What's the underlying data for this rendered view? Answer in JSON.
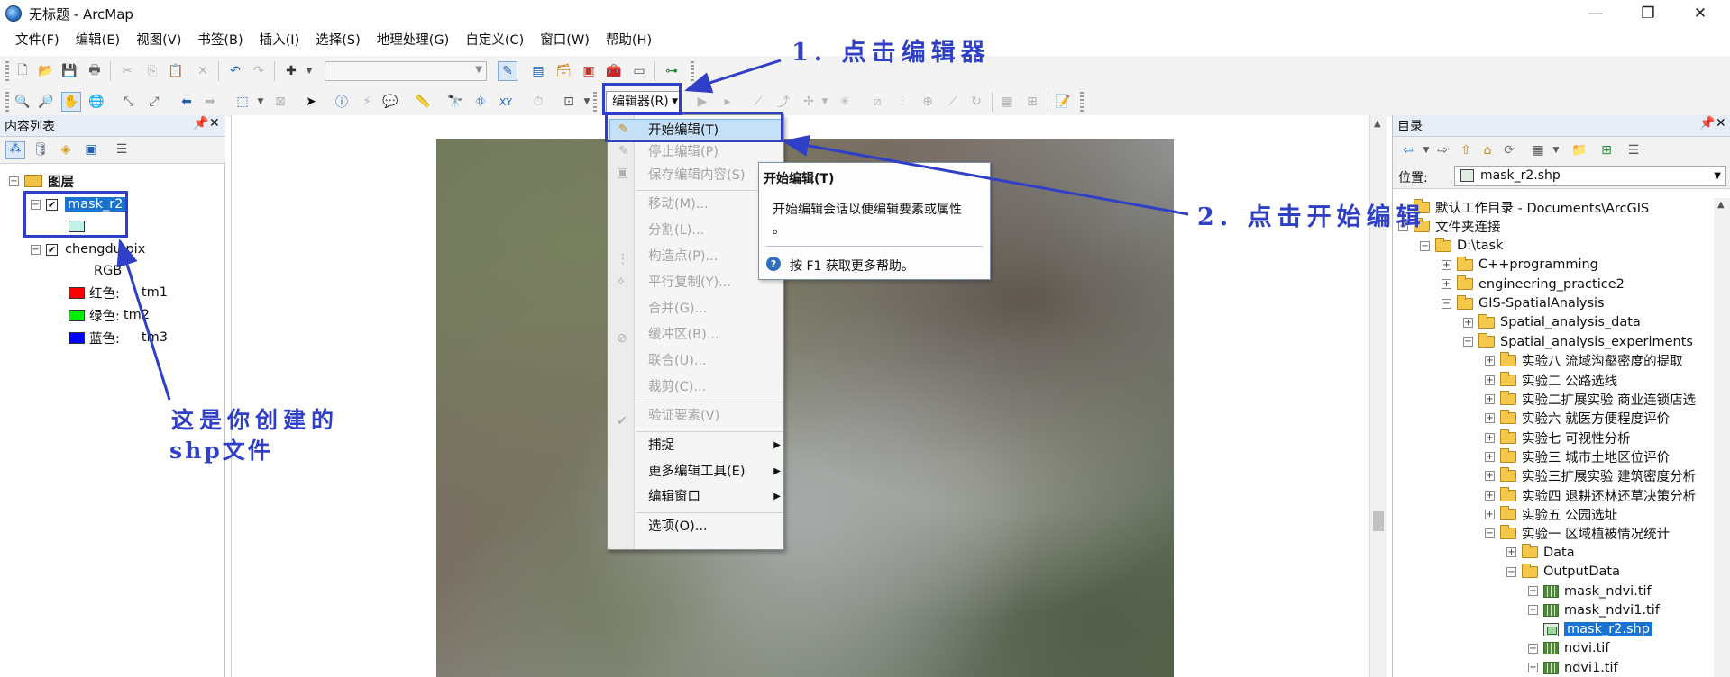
{
  "window": {
    "title": "无标题 - ArcMap",
    "minimize_glyph": "—",
    "maximize_glyph": "❐",
    "close_glyph": "✕"
  },
  "menubar": [
    "文件(F)",
    "编辑(E)",
    "视图(V)",
    "书签(B)",
    "插入(I)",
    "选择(S)",
    "地理处理(G)",
    "自定义(C)",
    "窗口(W)",
    "帮助(H)"
  ],
  "editor_toolbar": {
    "label": "编辑器(R)"
  },
  "toc": {
    "title": "内容列表",
    "root_label": "图层",
    "layers": [
      {
        "name": "mask_r2",
        "checked": true
      },
      {
        "name": "chengdu.pix",
        "checked": true,
        "subtitle": "RGB"
      }
    ],
    "bands": [
      {
        "label": "红色:",
        "value": "tm1",
        "color": "#ff0000"
      },
      {
        "label": "绿色:",
        "value": "tm2",
        "color": "#00ee00"
      },
      {
        "label": "蓝色:",
        "value": "tm3",
        "color": "#0000ff"
      }
    ],
    "mask_swatch_color": "#bff2ea"
  },
  "editor_menu": {
    "items": [
      {
        "label": "开始编辑(T)",
        "enabled": true,
        "highlighted": true
      },
      {
        "label": "停止编辑(P)",
        "enabled": false
      },
      {
        "label": "保存编辑内容(S)",
        "enabled": false
      },
      {
        "label": "移动(M)...",
        "enabled": false
      },
      {
        "label": "分割(L)...",
        "enabled": false
      },
      {
        "label": "构造点(P)...",
        "enabled": false
      },
      {
        "label": "平行复制(Y)...",
        "enabled": false
      },
      {
        "label": "合并(G)...",
        "enabled": false
      },
      {
        "label": "缓冲区(B)...",
        "enabled": false
      },
      {
        "label": "联合(U)...",
        "enabled": false
      },
      {
        "label": "裁剪(C)...",
        "enabled": false
      },
      {
        "label": "验证要素(V)",
        "enabled": false
      },
      {
        "label": "捕捉",
        "enabled": true,
        "submenu": true
      },
      {
        "label": "更多编辑工具(E)",
        "enabled": true,
        "submenu": true
      },
      {
        "label": "编辑窗口",
        "enabled": true,
        "submenu": true
      },
      {
        "label": "选项(O)...",
        "enabled": true
      }
    ]
  },
  "tooltip": {
    "title": "开始编辑(T)",
    "body_line1": "开始编辑会话以便编辑要素或属性",
    "body_line2": "。",
    "help": "按 F1 获取更多帮助。"
  },
  "catalog": {
    "title": "目录",
    "location_label": "位置:",
    "location_value": "mask_r2.shp",
    "tree": [
      {
        "label": "默认工作目录 - Documents\\ArcGIS",
        "indent": 0,
        "icon": "folder",
        "expander": ""
      },
      {
        "label": "文件夹连接",
        "indent": 0,
        "icon": "folder",
        "expander": "−"
      },
      {
        "label": "D:\\task",
        "indent": 1,
        "icon": "folder",
        "expander": "−"
      },
      {
        "label": "C++programming",
        "indent": 2,
        "icon": "folder",
        "expander": "+"
      },
      {
        "label": "engineering_practice2",
        "indent": 2,
        "icon": "folder",
        "expander": "+"
      },
      {
        "label": "GIS-SpatialAnalysis",
        "indent": 2,
        "icon": "folder",
        "expander": "−"
      },
      {
        "label": "Spatial_analysis_data",
        "indent": 3,
        "icon": "folder",
        "expander": "+"
      },
      {
        "label": "Spatial_analysis_experiments",
        "indent": 3,
        "icon": "folder",
        "expander": "−"
      },
      {
        "label": "实验八 流域沟壑密度的提取",
        "indent": 4,
        "icon": "folder",
        "expander": "+"
      },
      {
        "label": "实验二 公路选线",
        "indent": 4,
        "icon": "folder",
        "expander": "+"
      },
      {
        "label": "实验二扩展实验 商业连锁店选",
        "indent": 4,
        "icon": "folder",
        "expander": "+"
      },
      {
        "label": "实验六 就医方便程度评价",
        "indent": 4,
        "icon": "folder",
        "expander": "+"
      },
      {
        "label": "实验七 可视性分析",
        "indent": 4,
        "icon": "folder",
        "expander": "+"
      },
      {
        "label": "实验三 城市土地区位评价",
        "indent": 4,
        "icon": "folder",
        "expander": "+"
      },
      {
        "label": "实验三扩展实验 建筑密度分析",
        "indent": 4,
        "icon": "folder",
        "expander": "+"
      },
      {
        "label": "实验四 退耕还林还草决策分析",
        "indent": 4,
        "icon": "folder",
        "expander": "+"
      },
      {
        "label": "实验五 公园选址",
        "indent": 4,
        "icon": "folder",
        "expander": "+"
      },
      {
        "label": "实验一 区域植被情况统计",
        "indent": 4,
        "icon": "folder",
        "expander": "−"
      },
      {
        "label": "Data",
        "indent": 5,
        "icon": "folder",
        "expander": "+"
      },
      {
        "label": "OutputData",
        "indent": 5,
        "icon": "folder",
        "expander": "−"
      },
      {
        "label": "mask_ndvi.tif",
        "indent": 6,
        "icon": "raster",
        "expander": "+"
      },
      {
        "label": "mask_ndvi1.tif",
        "indent": 6,
        "icon": "raster",
        "expander": "+"
      },
      {
        "label": "mask_r2.shp",
        "indent": 6,
        "icon": "shp",
        "expander": "",
        "selected": true
      },
      {
        "label": "ndvi.tif",
        "indent": 6,
        "icon": "raster",
        "expander": "+"
      },
      {
        "label": "ndvi1.tif",
        "indent": 6,
        "icon": "raster",
        "expander": "+"
      }
    ]
  },
  "annotations": {
    "step1": "1. 点击编辑器",
    "step2": "2. 点击开始编辑",
    "note_line1": "这是你创建的",
    "note_line2": "shp文件",
    "color": "#2f3fc6"
  }
}
